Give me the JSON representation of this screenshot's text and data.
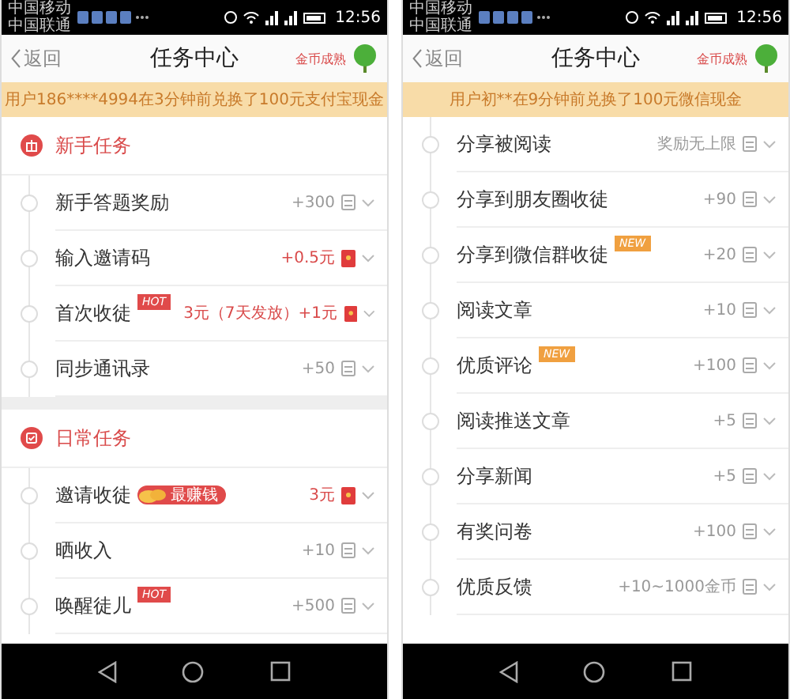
{
  "screens": [
    {
      "status_bar": {
        "carriers": [
          "中国移动",
          "中国联通"
        ],
        "time": "12:56"
      },
      "header": {
        "back": "返回",
        "title": "任务中心",
        "link": "金币成熟"
      },
      "banner": "用户186****4994在3分钟前兑换了100元支付宝现金",
      "sections": [
        {
          "title": "新手任务",
          "kind": "newbie",
          "tasks": [
            {
              "name": "新手答题奖励",
              "reward": "+300",
              "kind": "coin"
            },
            {
              "name": "输入邀请码",
              "reward": "+0.5元",
              "kind": "cash"
            },
            {
              "name": "首次收徒",
              "badge": {
                "kind": "hot",
                "text": "HOT"
              },
              "reward": "3元（7天发放）+1元",
              "kind": "cash"
            },
            {
              "name": "同步通讯录",
              "reward": "+50",
              "kind": "coin"
            }
          ]
        },
        {
          "title": "日常任务",
          "kind": "daily",
          "tasks": [
            {
              "name": "邀请收徒",
              "badge": {
                "kind": "coins",
                "text": "最赚钱"
              },
              "reward": "3元",
              "kind": "cash"
            },
            {
              "name": "晒收入",
              "reward": "+10",
              "kind": "coin"
            },
            {
              "name": "唤醒徒儿",
              "badge": {
                "kind": "hot",
                "text": "HOT"
              },
              "reward": "+500",
              "kind": "coin"
            }
          ]
        }
      ]
    },
    {
      "status_bar": {
        "carriers": [
          "中国移动",
          "中国联通"
        ],
        "time": "12:56"
      },
      "header": {
        "back": "返回",
        "title": "任务中心",
        "link": "金币成熟"
      },
      "banner": "用户初**在9分钟前兑换了100元微信现金",
      "sections": [
        {
          "tasks": [
            {
              "name": "分享被阅读",
              "reward": "奖励无上限",
              "kind": "coin"
            },
            {
              "name": "分享到朋友圈收徒",
              "reward": "+90",
              "kind": "coin"
            },
            {
              "name": "分享到微信群收徒",
              "badge": {
                "kind": "new",
                "text": "NEW"
              },
              "reward": "+20",
              "kind": "coin"
            },
            {
              "name": "阅读文章",
              "reward": "+10",
              "kind": "coin"
            },
            {
              "name": "优质评论",
              "badge": {
                "kind": "new",
                "text": "NEW"
              },
              "reward": "+100",
              "kind": "coin"
            },
            {
              "name": "阅读推送文章",
              "reward": "+5",
              "kind": "coin"
            },
            {
              "name": "分享新闻",
              "reward": "+5",
              "kind": "coin"
            },
            {
              "name": "有奖问卷",
              "reward": "+100",
              "kind": "coin"
            },
            {
              "name": "优质反馈",
              "reward": "+10~1000金币",
              "kind": "coin"
            }
          ]
        }
      ]
    }
  ]
}
